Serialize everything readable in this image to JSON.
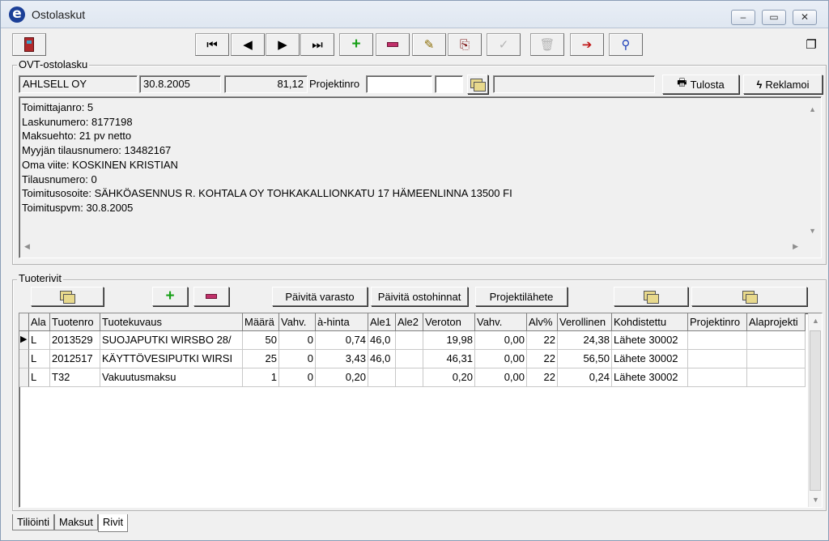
{
  "window": {
    "title": "Ostolaskut",
    "app_icon_letter": "e",
    "controls": {
      "minimize": "–",
      "maximize": "▭",
      "close": "✕"
    }
  },
  "toolbar": {
    "first_glyph": "⏮",
    "prev_glyph": "◀",
    "next_glyph": "▶",
    "last_glyph": "⏭",
    "edit_glyph": "✎",
    "copy_glyph": "⎘",
    "confirm_glyph": "✓",
    "delete_glyph": "🗑",
    "export_glyph": "➔",
    "find_glyph": "⚲",
    "windows_glyph": "❐"
  },
  "invoice": {
    "group_label": "OVT-ostolasku",
    "supplier": "AHLSELL OY",
    "date": "30.8.2005",
    "amount": "81,12",
    "project_label": "Projektinro",
    "project_value": "",
    "project_sub": "",
    "project_name": "",
    "print_label": "Tulosta",
    "reclaim_label": "Reklamoi",
    "print_glyph": "🖶",
    "reclaim_glyph": "ϟ",
    "details": [
      "Toimittajanro: 5",
      "Laskunumero: 8177198",
      "Maksuehto: 21 pv netto",
      "Myyjän tilausnumero: 13482167",
      "Oma viite: KOSKINEN KRISTIAN",
      "Tilausnumero: 0",
      "Toimitusosoite: SÄHKÖASENNUS R. KOHTALA OY TOHKAKALLIONKATU 17 HÄMEENLINNA 13500 FI",
      "Toimituspvm: 30.8.2005"
    ]
  },
  "rows_section": {
    "group_label": "Tuoterivit",
    "update_stock_label": "Päivitä varasto",
    "update_prices_label": "Päivitä ostohinnat",
    "project_note_label": "Projektilähete"
  },
  "grid": {
    "columns": [
      "",
      "Ala",
      "Tuotenro",
      "Tuotekuvaus",
      "Määrä",
      "Vahv.",
      "à-hinta",
      "Ale1",
      "Ale2",
      "Veroton",
      "Vahv.",
      "Alv%",
      "Verollinen",
      "Kohdistettu",
      "Projektinro",
      "Alaprojekti"
    ],
    "rows": [
      [
        "▶",
        "L",
        "2013529",
        "SUOJAPUTKI WIRSBO 28/",
        "50",
        "0",
        "0,74",
        "46,0",
        "",
        "19,98",
        "0,00",
        "22",
        "24,38",
        "Lähete 30002",
        "",
        ""
      ],
      [
        "",
        "L",
        "2012517",
        "KÄYTTÖVESIPUTKI WIRSI",
        "25",
        "0",
        "3,43",
        "46,0",
        "",
        "46,31",
        "0,00",
        "22",
        "56,50",
        "Lähete 30002",
        "",
        ""
      ],
      [
        "",
        "L",
        "T32",
        "Vakuutusmaksu",
        "1",
        "0",
        "0,20",
        "",
        "",
        "0,20",
        "0,00",
        "22",
        "0,24",
        "Lähete 30002",
        "",
        ""
      ]
    ]
  },
  "tabs": [
    "Tiliöinti",
    "Maksut",
    "Rivit"
  ],
  "active_tab": "Rivit"
}
